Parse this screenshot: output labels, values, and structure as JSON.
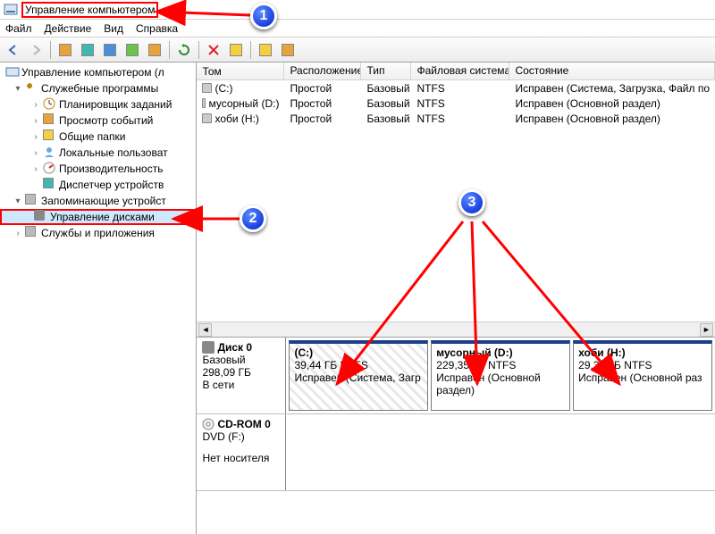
{
  "title": "Управление компьютером",
  "menu": [
    "Файл",
    "Действие",
    "Вид",
    "Справка"
  ],
  "tree": {
    "root": "Управление компьютером (л",
    "group1": "Служебные программы",
    "items1": [
      "Планировщик заданий",
      "Просмотр событий",
      "Общие папки",
      "Локальные пользоват",
      "Производительность",
      "Диспетчер устройств"
    ],
    "group2": "Запоминающие устройст",
    "disk_mgmt": "Управление дисками",
    "group3": "Службы и приложения"
  },
  "columns": {
    "tom": "Том",
    "loc": "Расположение",
    "type": "Тип",
    "fs": "Файловая система",
    "stat": "Состояние"
  },
  "volumes": [
    {
      "tom": "(C:)",
      "loc": "Простой",
      "type": "Базовый",
      "fs": "NTFS",
      "stat": "Исправен (Система, Загрузка, Файл по"
    },
    {
      "tom": "мусорный (D:)",
      "loc": "Простой",
      "type": "Базовый",
      "fs": "NTFS",
      "stat": "Исправен (Основной раздел)"
    },
    {
      "tom": "хоби (H:)",
      "loc": "Простой",
      "type": "Базовый",
      "fs": "NTFS",
      "stat": "Исправен (Основной раздел)"
    }
  ],
  "disk0": {
    "name": "Диск 0",
    "type": "Базовый",
    "size": "298,09 ГБ",
    "state": "В сети",
    "parts": [
      {
        "name": "(C:)",
        "size": "39,44 ГБ NTFS",
        "stat": "Исправен (Система, Загр"
      },
      {
        "name": "мусорный  (D:)",
        "size": "229,35 ГБ NTFS",
        "stat": "Исправен (Основной раздел)"
      },
      {
        "name": "хоби  (H:)",
        "size": "29,30 ГБ NTFS",
        "stat": "Исправен (Основной раз"
      }
    ]
  },
  "cdrom": {
    "name": "CD-ROM 0",
    "type": "DVD (F:)",
    "state": "Нет носителя"
  },
  "callouts": {
    "1": "1",
    "2": "2",
    "3": "3"
  }
}
